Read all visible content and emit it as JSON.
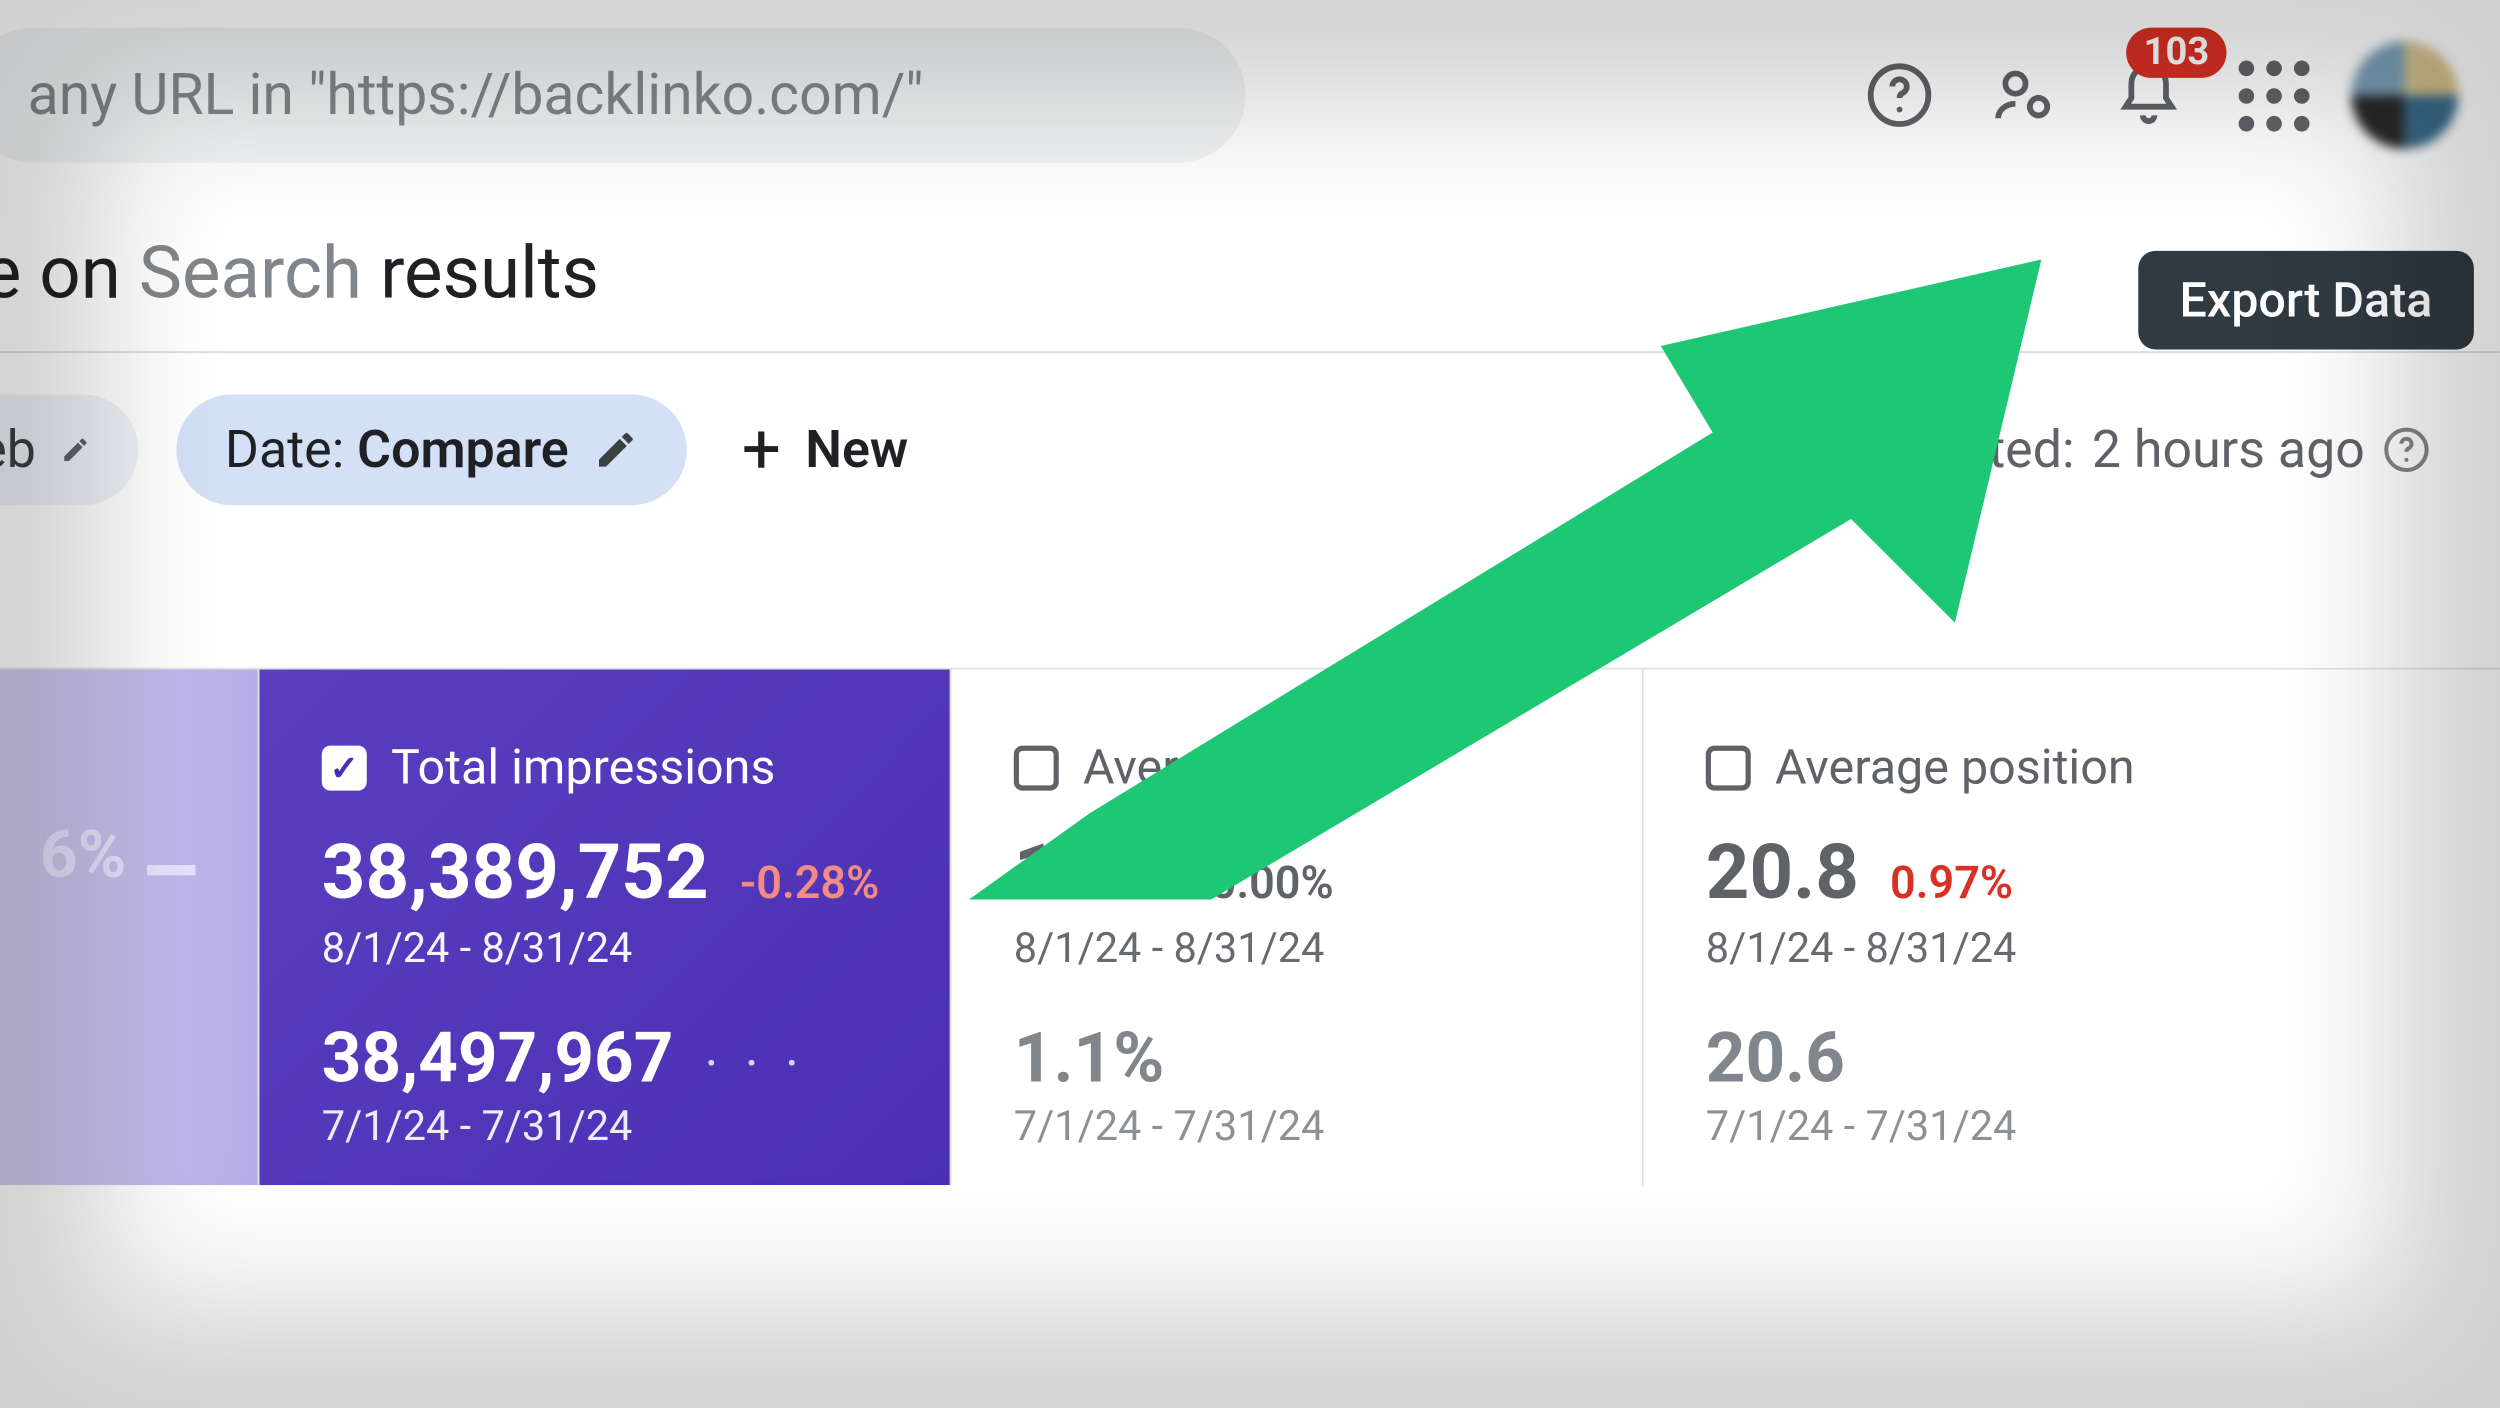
{
  "header": {
    "search_text": "any URL in \"https://backlinko.com/\"",
    "notification_count": "103"
  },
  "tooltip": {
    "text": "Export Data"
  },
  "page": {
    "title_prefix": "e on ",
    "title_light": "Search",
    "title_suffix": " results",
    "export_label": "EXPORT"
  },
  "filters": {
    "prev_chip_tail": "eb",
    "date_label": "Date: ",
    "date_value": "Compare",
    "new_label": "New",
    "updated_prefix": "updated: ",
    "updated_value": "2 hours ago"
  },
  "metrics": {
    "clicks": {
      "value_tail": "6%"
    },
    "impressions": {
      "label": "Total impressions",
      "value": "38,389,752",
      "delta": "-0.28%",
      "range": "8/1/24 - 8/31/24",
      "value2": "38,497,967",
      "range2": "7/1/24 - 7/31/24"
    },
    "ctr": {
      "label": "Average CTR",
      "value": "1.1%",
      "delta": "0.00%",
      "range": "8/1/24 - 8/31/24",
      "value2": "1.1%",
      "range2": "7/1/24 - 7/31/24"
    },
    "position": {
      "label": "Average position",
      "value": "20.8",
      "delta": "0.97%",
      "range": "8/1/24 - 8/31/24",
      "value2": "20.6",
      "range2": "7/1/24 - 7/31/24"
    }
  }
}
